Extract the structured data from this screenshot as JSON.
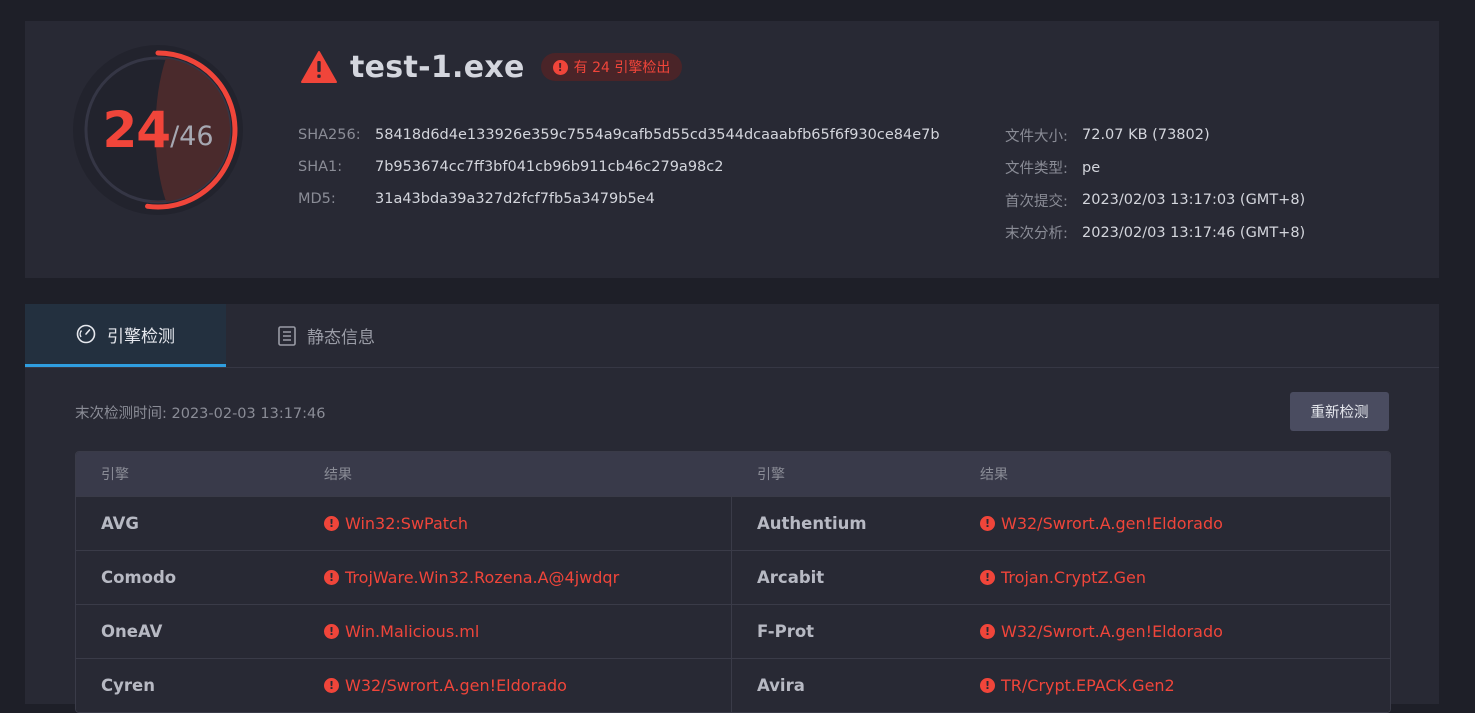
{
  "summary": {
    "detections": "24",
    "total": "/46",
    "file_name": "test-1.exe",
    "badge_text": "有 24 引擎检出",
    "detection_ratio": 0.5217,
    "hashes": [
      {
        "key": "SHA256:",
        "value": "58418d6d4e133926e359c7554a9cafb5d55cd3544dcaaabfb65f6f930ce84e7b"
      },
      {
        "key": "SHA1:",
        "value": "7b953674cc7ff3bf041cb96b911cb46c279a98c2"
      },
      {
        "key": "MD5:",
        "value": "31a43bda39a327d2fcf7fb5a3479b5e4"
      }
    ],
    "meta": [
      {
        "key": "文件大小:",
        "value": "72.07 KB (73802)"
      },
      {
        "key": "文件类型:",
        "value": "pe"
      },
      {
        "key": "首次提交:",
        "value": "2023/02/03 13:17:03 (GMT+8)"
      },
      {
        "key": "末次分析:",
        "value": "2023/02/03 13:17:46 (GMT+8)"
      }
    ]
  },
  "tabs": [
    {
      "label": "引擎检测",
      "icon": "gauge-icon",
      "active": true
    },
    {
      "label": "静态信息",
      "icon": "document-list-icon",
      "active": false
    }
  ],
  "scan": {
    "last_scan": "末次检测时间: 2023-02-03 13:17:46",
    "rescan_label": "重新检测"
  },
  "table": {
    "headers": [
      "引擎",
      "结果",
      "引擎",
      "结果"
    ],
    "rows": [
      {
        "e1": "AVG",
        "r1": "Win32:SwPatch",
        "e2": "Authentium",
        "r2": "W32/Swrort.A.gen!Eldorado"
      },
      {
        "e1": "Comodo",
        "r1": "TrojWare.Win32.Rozena.A@4jwdqr",
        "e2": "Arcabit",
        "r2": "Trojan.CryptZ.Gen"
      },
      {
        "e1": "OneAV",
        "r1": "Win.Malicious.ml",
        "e2": "F-Prot",
        "r2": "W32/Swrort.A.gen!Eldorado"
      },
      {
        "e1": "Cyren",
        "r1": "W32/Swrort.A.gen!Eldorado",
        "e2": "Avira",
        "r2": "TR/Crypt.EPACK.Gen2"
      }
    ]
  },
  "colors": {
    "danger": "#f0453a",
    "accent": "#2f9ee0",
    "panel": "#282934",
    "background": "#1e1f28"
  }
}
